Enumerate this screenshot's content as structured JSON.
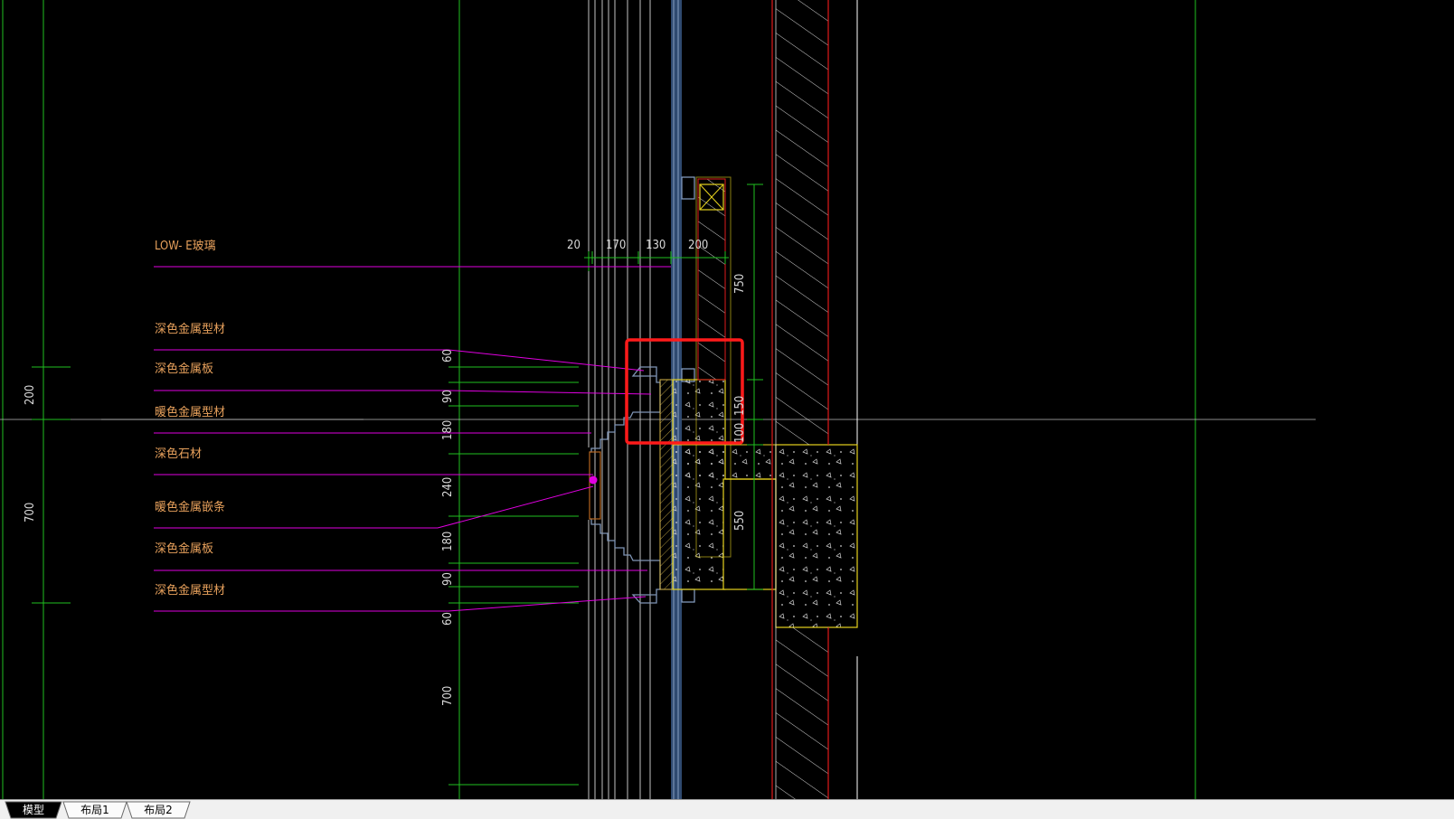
{
  "drawing": {
    "material_labels": [
      "LOW- E玻璃",
      "深色金属型材",
      "深色金属板",
      "暖色金属型材",
      "深色石材",
      "暖色金属嵌条",
      "深色金属板",
      "深色金属型材"
    ],
    "top_dimensions": [
      "20",
      "170",
      "130",
      "200"
    ],
    "left_dimensions": [
      "200",
      "700"
    ],
    "row_dimensions": [
      "60",
      "90",
      "180",
      "240",
      "180",
      "90",
      "60",
      "700"
    ],
    "right_dimensions": [
      "750",
      "150",
      "100",
      "550"
    ]
  },
  "tabs": [
    {
      "label": "模型",
      "active": true
    },
    {
      "label": "布局1",
      "active": false
    },
    {
      "label": "布局2",
      "active": false
    }
  ],
  "colors": {
    "background": "#000000",
    "label": "#e8a15c",
    "leader": "#e100e1",
    "grid": "#1fbf1f",
    "mullion": "#3f5f8f",
    "wall": "#ffffff",
    "concrete_outline": "#e6d21e",
    "red_line": "#e11b1b",
    "highlight": "#ff1a1a"
  }
}
